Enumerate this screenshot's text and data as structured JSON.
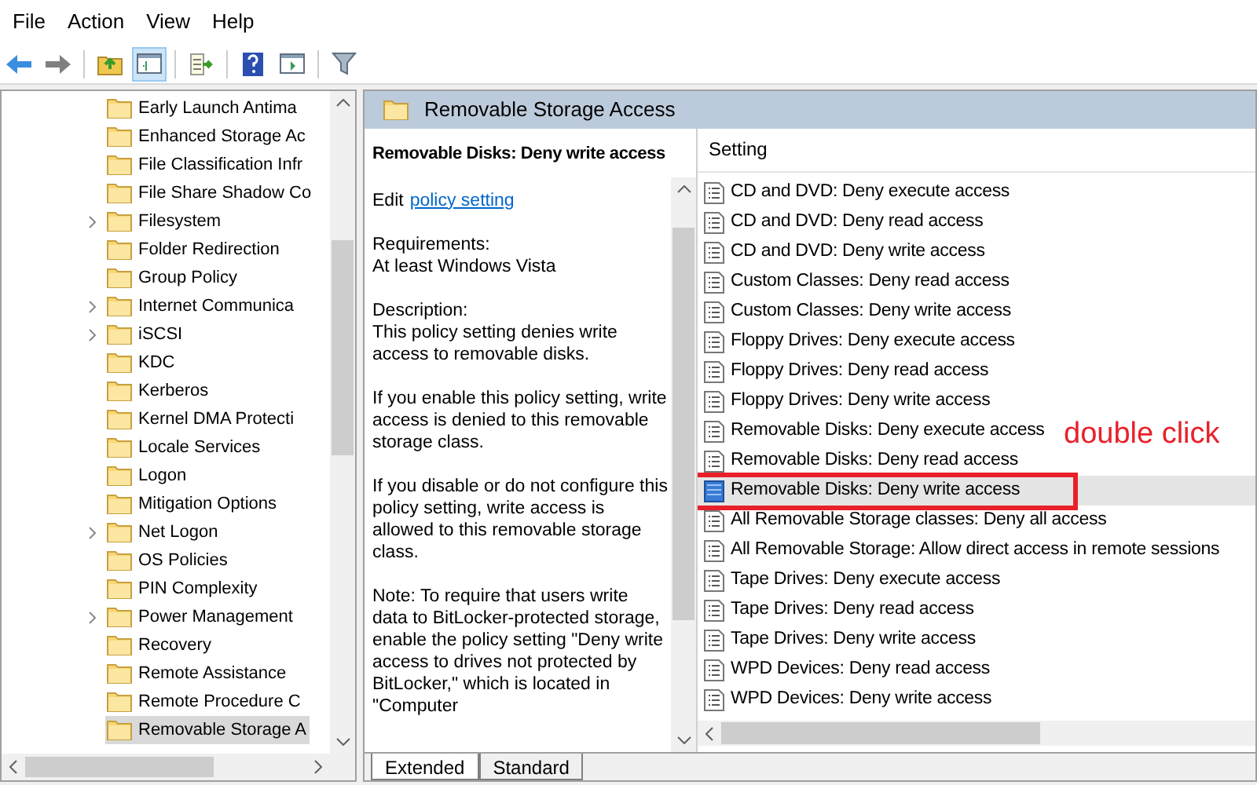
{
  "menu": [
    "File",
    "Action",
    "View",
    "Help"
  ],
  "tree": {
    "items": [
      {
        "label": "Early Launch Antima",
        "expandable": false,
        "selected": false
      },
      {
        "label": "Enhanced Storage Ac",
        "expandable": false,
        "selected": false
      },
      {
        "label": "File Classification Infr",
        "expandable": false,
        "selected": false
      },
      {
        "label": "File Share Shadow Co",
        "expandable": false,
        "selected": false
      },
      {
        "label": "Filesystem",
        "expandable": true,
        "selected": false
      },
      {
        "label": "Folder Redirection",
        "expandable": false,
        "selected": false
      },
      {
        "label": "Group Policy",
        "expandable": false,
        "selected": false
      },
      {
        "label": "Internet Communica",
        "expandable": true,
        "selected": false
      },
      {
        "label": "iSCSI",
        "expandable": true,
        "selected": false
      },
      {
        "label": "KDC",
        "expandable": false,
        "selected": false
      },
      {
        "label": "Kerberos",
        "expandable": false,
        "selected": false
      },
      {
        "label": "Kernel DMA Protecti",
        "expandable": false,
        "selected": false
      },
      {
        "label": "Locale Services",
        "expandable": false,
        "selected": false
      },
      {
        "label": "Logon",
        "expandable": false,
        "selected": false
      },
      {
        "label": "Mitigation Options",
        "expandable": false,
        "selected": false
      },
      {
        "label": "Net Logon",
        "expandable": true,
        "selected": false
      },
      {
        "label": "OS Policies",
        "expandable": false,
        "selected": false
      },
      {
        "label": "PIN Complexity",
        "expandable": false,
        "selected": false
      },
      {
        "label": "Power Management",
        "expandable": true,
        "selected": false
      },
      {
        "label": "Recovery",
        "expandable": false,
        "selected": false
      },
      {
        "label": "Remote Assistance",
        "expandable": false,
        "selected": false
      },
      {
        "label": "Remote Procedure C",
        "expandable": false,
        "selected": false
      },
      {
        "label": "Removable Storage A",
        "expandable": false,
        "selected": true
      }
    ]
  },
  "panel": {
    "title": "Removable Storage Access",
    "description": {
      "heading": "Removable Disks: Deny write access",
      "edit_prefix": "Edit",
      "edit_link": "policy setting",
      "paragraphs": [
        [
          "Requirements:",
          "At least Windows Vista"
        ],
        [
          "Description:",
          "This policy setting denies write access to removable disks."
        ],
        [
          "If you enable this policy setting, write access is denied to this removable storage class."
        ],
        [
          "If you disable or do not configure this policy setting, write access is allowed to this removable storage class."
        ],
        [
          "Note: To require that users write data to BitLocker-protected storage, enable the policy setting \"Deny write access to drives not protected by BitLocker,\" which is located in \"Computer"
        ]
      ]
    },
    "settings": {
      "column": "Setting",
      "rows": [
        {
          "label": "CD and DVD: Deny execute access",
          "selected": false
        },
        {
          "label": "CD and DVD: Deny read access",
          "selected": false
        },
        {
          "label": "CD and DVD: Deny write access",
          "selected": false
        },
        {
          "label": "Custom Classes: Deny read access",
          "selected": false
        },
        {
          "label": "Custom Classes: Deny write access",
          "selected": false
        },
        {
          "label": "Floppy Drives: Deny execute access",
          "selected": false
        },
        {
          "label": "Floppy Drives: Deny read access",
          "selected": false
        },
        {
          "label": "Floppy Drives: Deny write access",
          "selected": false
        },
        {
          "label": "Removable Disks: Deny execute access",
          "selected": false
        },
        {
          "label": "Removable Disks: Deny read access",
          "selected": false
        },
        {
          "label": "Removable Disks: Deny write access",
          "selected": true
        },
        {
          "label": "All Removable Storage classes: Deny all access",
          "selected": false
        },
        {
          "label": "All Removable Storage: Allow direct access in remote sessions",
          "selected": false
        },
        {
          "label": "Tape Drives: Deny execute access",
          "selected": false
        },
        {
          "label": "Tape Drives: Deny read access",
          "selected": false
        },
        {
          "label": "Tape Drives: Deny write access",
          "selected": false
        },
        {
          "label": "WPD Devices: Deny read access",
          "selected": false
        },
        {
          "label": "WPD Devices: Deny write access",
          "selected": false
        }
      ]
    },
    "annotation": "double click",
    "tabs": [
      {
        "label": "Extended",
        "selected": true
      },
      {
        "label": "Standard",
        "selected": false
      }
    ]
  }
}
